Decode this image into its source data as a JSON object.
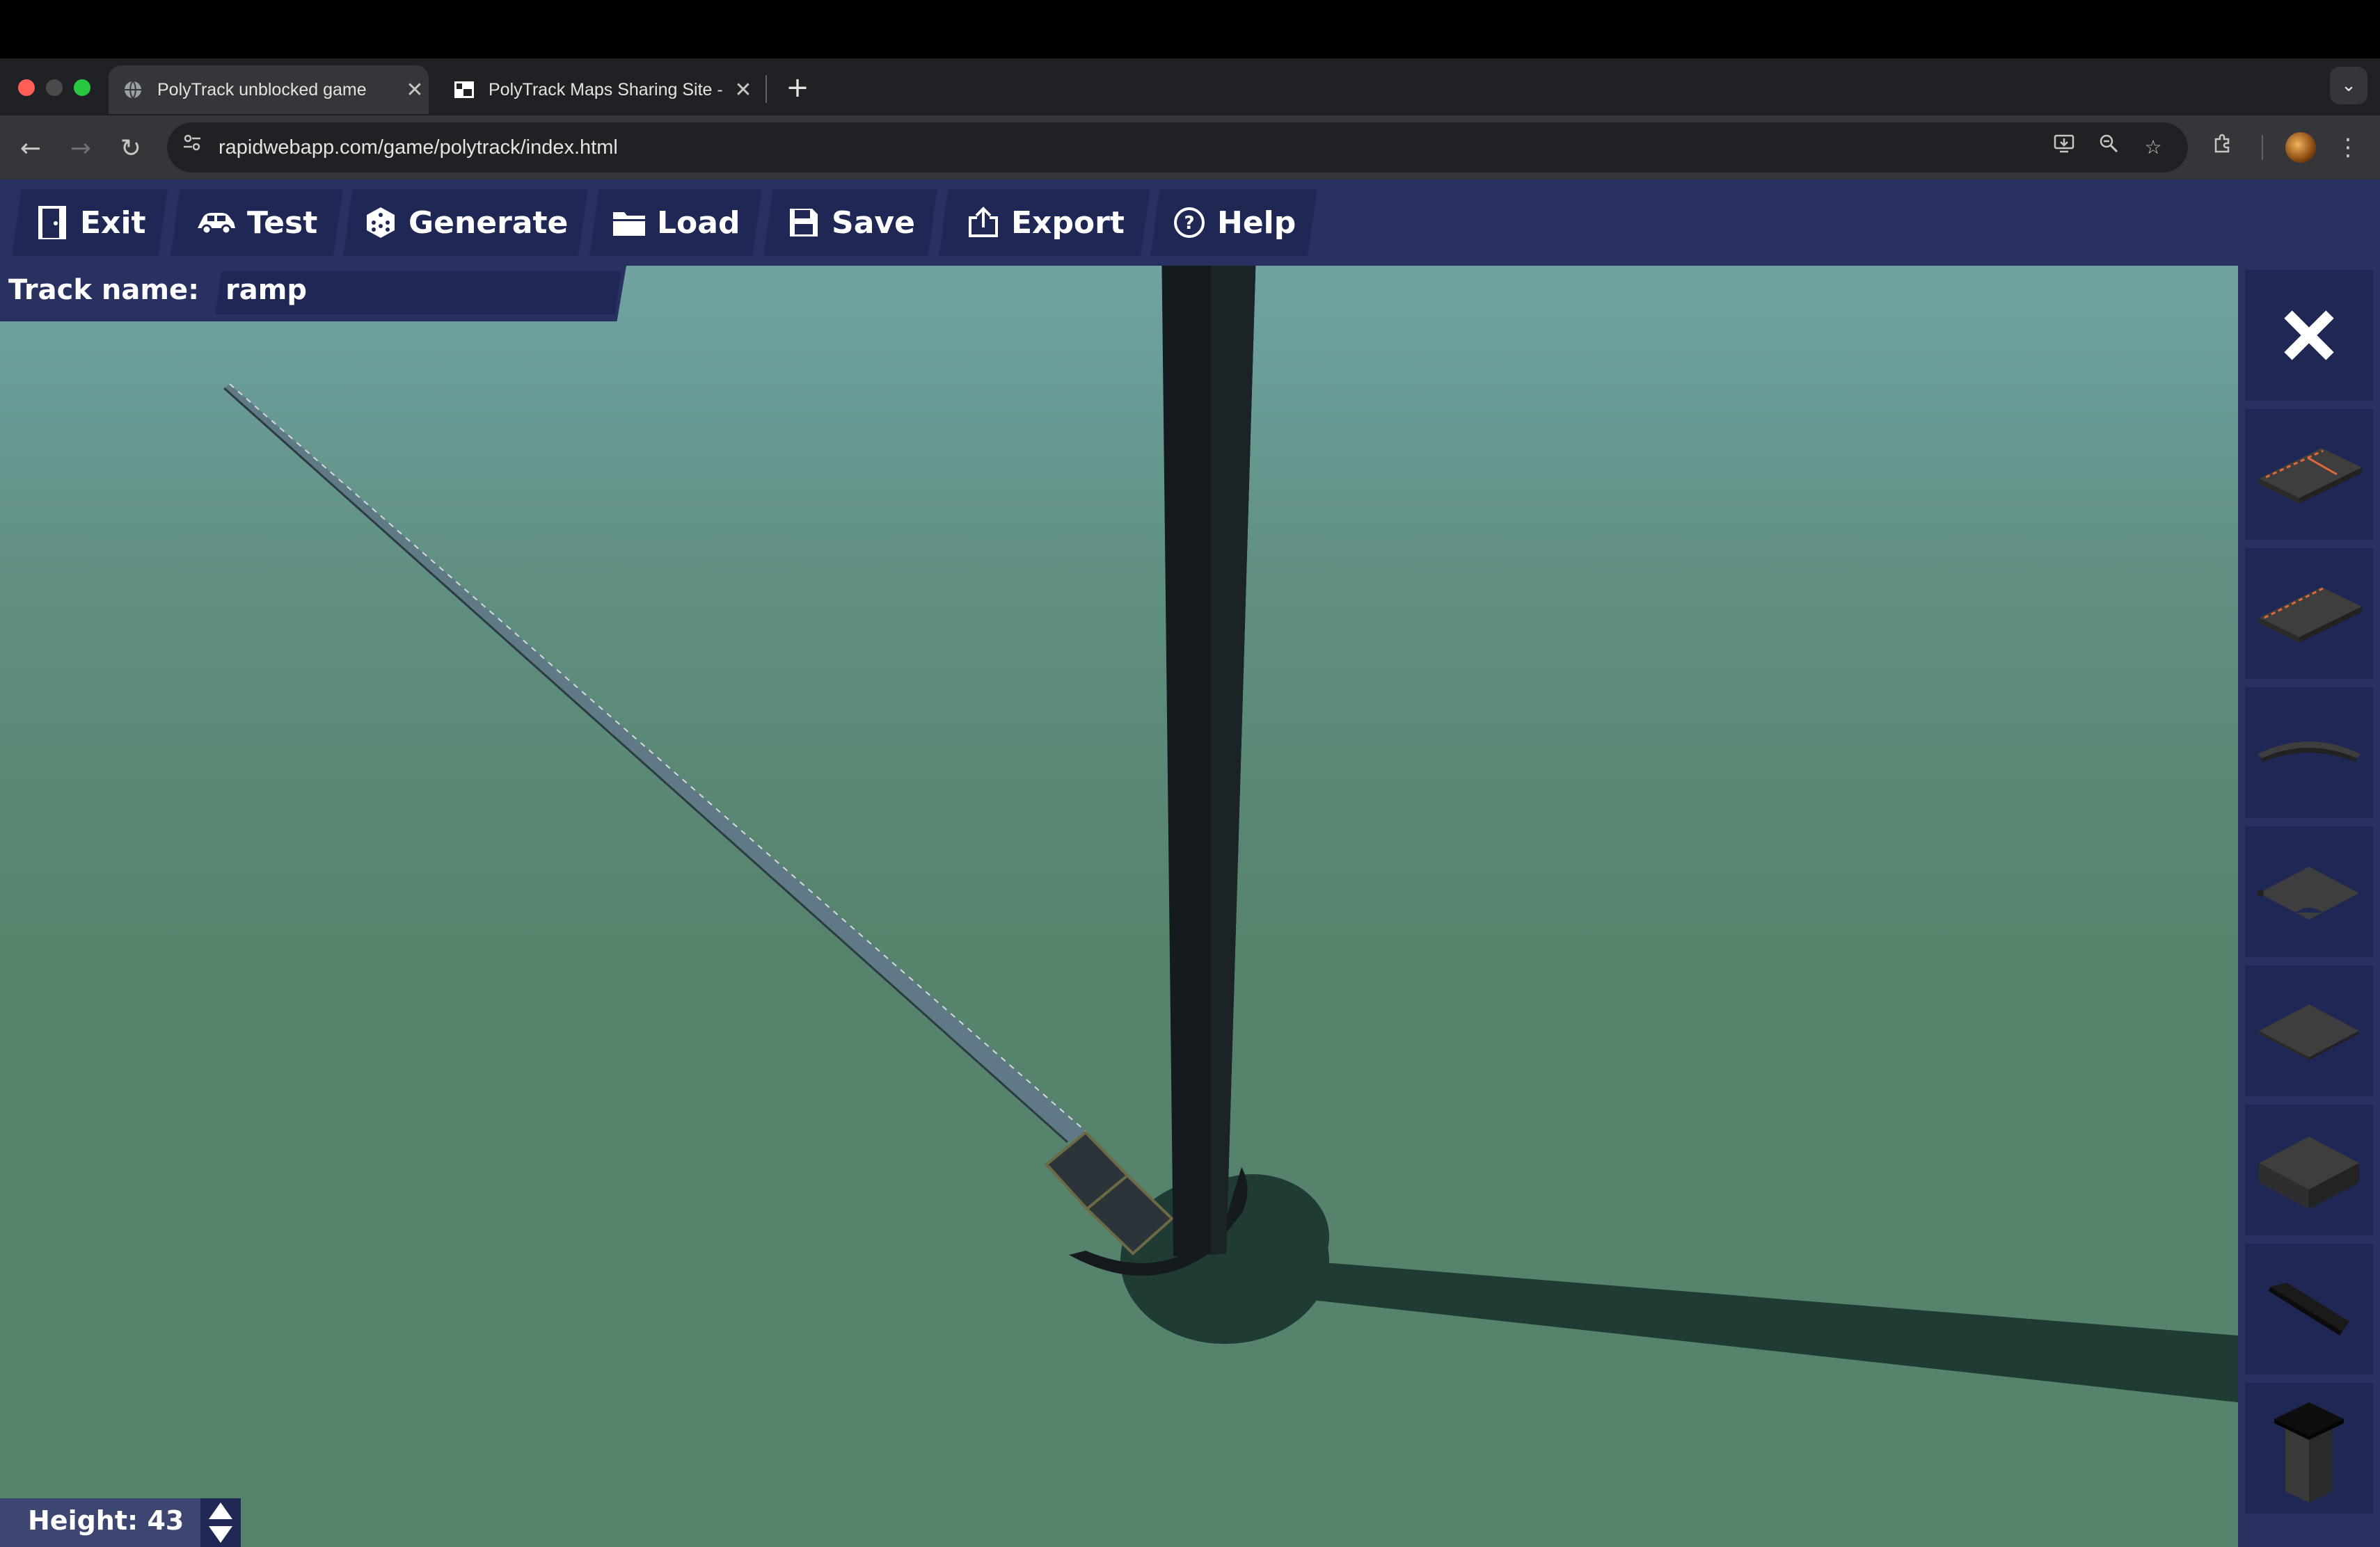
{
  "browser": {
    "tabs": [
      {
        "title": "PolyTrack unblocked game",
        "active": true
      },
      {
        "title": "PolyTrack Maps Sharing Site -",
        "active": false
      }
    ],
    "url": "rapidwebapp.com/game/polytrack/index.html",
    "icons": [
      "back-icon",
      "forward-icon",
      "reload-icon",
      "site-info-icon",
      "install-icon",
      "zoom-icon",
      "bookmark-star-icon",
      "extensions-icon",
      "profile-avatar",
      "menu-icon"
    ]
  },
  "editor": {
    "toolbar": {
      "exit": "Exit",
      "test": "Test",
      "generate": "Generate",
      "load": "Load",
      "save": "Save",
      "export": "Export",
      "help": "Help"
    },
    "track_name_label": "Track name:",
    "track_name_value": "ramp",
    "height_label": "Height: 43",
    "sidebar_pieces": [
      "start-piece",
      "finish-piece",
      "curve-piece",
      "turn-piece",
      "flat-tile-piece",
      "block-piece",
      "ramp-piece",
      "pillar-piece"
    ]
  },
  "colors": {
    "toolbar_bg": "#283160",
    "button_bg": "#1f2754",
    "sky_top": "#76a9a8",
    "ground": "#56836c",
    "pillar": "#141a1d"
  }
}
